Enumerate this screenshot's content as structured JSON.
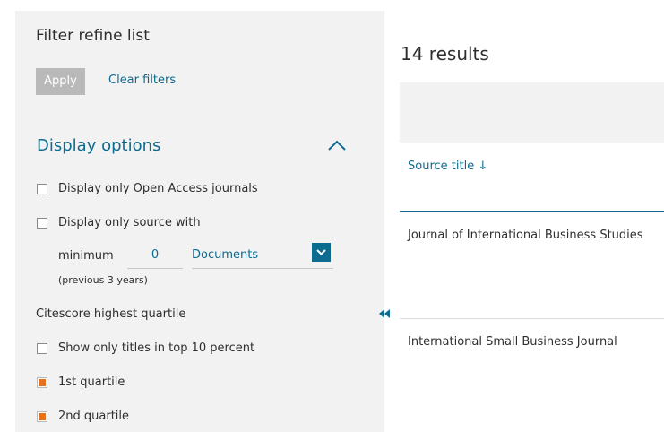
{
  "filters": {
    "title": "Filter refine list",
    "apply_label": "Apply",
    "clear_label": "Clear filters",
    "display_options": {
      "heading": "Display options",
      "open_access_label": "Display only Open Access journals",
      "source_with_label": "Display only source with",
      "minimum_label": "minimum",
      "minimum_value": "0",
      "documents_select": "Documents",
      "previous_years": "(previous 3 years)"
    },
    "citescore": {
      "heading": "Citescore highest quartile",
      "top10_label": "Show only titles in top 10 percent",
      "q1_label": "1st quartile",
      "q2_label": "2nd quartile"
    }
  },
  "results": {
    "count": "14 results",
    "column_header": "Source title ↓",
    "rows": [
      "Journal of International Business Studies",
      "International Small Business Journal"
    ]
  },
  "colors": {
    "accent": "#0c6b8f",
    "checkbox_checked": "#e9711c",
    "panel_bg": "#f2f2f2"
  },
  "icons": {
    "collapse": "chevron-up-icon",
    "select": "chevron-down-icon",
    "panel_toggle": "double-chevron-left-icon"
  }
}
